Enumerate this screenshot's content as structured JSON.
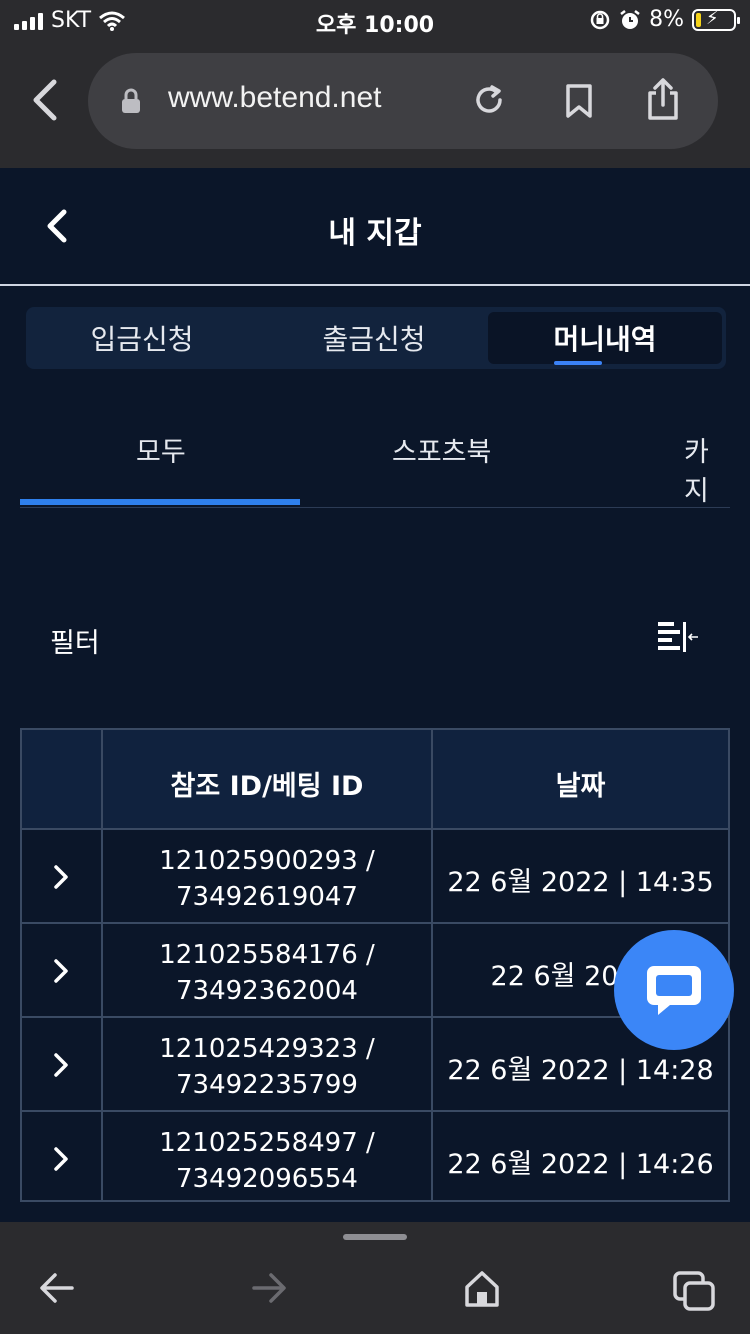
{
  "status_bar": {
    "carrier": "SKT",
    "time": "오후 10:00",
    "battery": "8%",
    "icons": [
      "signal-icon",
      "wifi-icon",
      "orientation-lock-icon",
      "alarm-icon",
      "battery-charging-icon"
    ]
  },
  "browser": {
    "url": "www.betend.net",
    "icons": [
      "back-chevron-icon",
      "lock-icon",
      "reload-icon",
      "bookmark-icon",
      "share-icon"
    ]
  },
  "header": {
    "title": "내 지갑"
  },
  "wallet_tabs": {
    "items": [
      {
        "label": "입금신청"
      },
      {
        "label": "출금신청"
      },
      {
        "label": "머니내역"
      }
    ],
    "active": "머니내역"
  },
  "sub_tabs": {
    "items": [
      {
        "label": "모두"
      },
      {
        "label": "스포츠북"
      },
      {
        "label": "카지"
      }
    ],
    "active": "모두"
  },
  "filter": {
    "label": "필터"
  },
  "table": {
    "columns": [
      "참조 ID/베팅 ID",
      "날짜"
    ],
    "rows": [
      {
        "ref_id": "121025900293 /",
        "bet_id": "73492619047",
        "date": "22 6월 2022 | 14:35"
      },
      {
        "ref_id": "121025584176 /",
        "bet_id": "73492362004",
        "date": "22 6월 2022 |"
      },
      {
        "ref_id": "121025429323 /",
        "bet_id": "73492235799",
        "date": "22 6월 2022 | 14:28"
      },
      {
        "ref_id": "121025258497 /",
        "bet_id": "73492096554",
        "date": "22 6월 2022 | 14:26"
      }
    ]
  },
  "colors": {
    "page_bg": "#0b1629",
    "accent": "#3b82f6",
    "chat_fab": "#3b86f7",
    "safari_chrome": "#2b2b2e"
  }
}
